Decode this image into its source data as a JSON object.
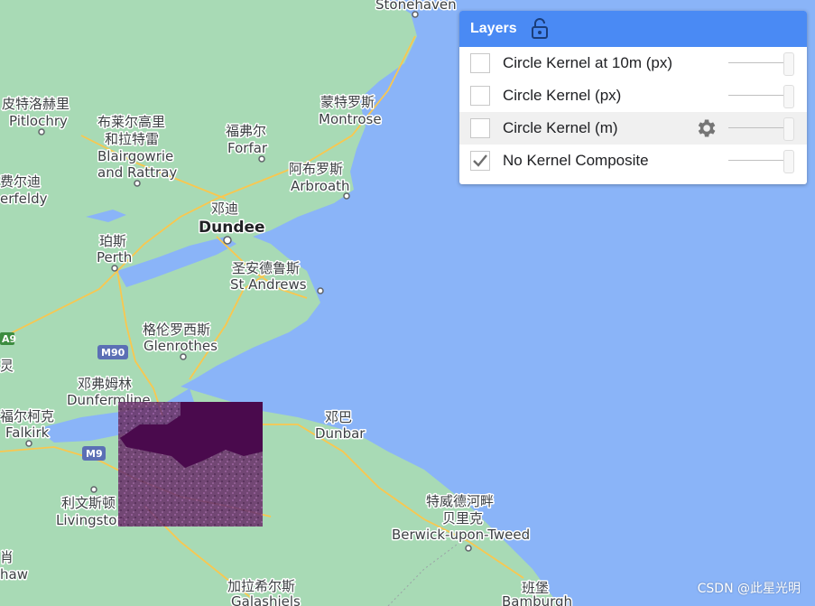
{
  "map": {
    "places": [
      {
        "id": "stonehaven",
        "en": "Stonehaven"
      },
      {
        "id": "pitlochry",
        "zh": "皮特洛赫里",
        "en": "Pitlochry"
      },
      {
        "id": "blairgowrie",
        "zh1": "布莱尔高里",
        "zh2": "和拉特雷",
        "en1": "Blairgowrie",
        "en2": "and Rattray"
      },
      {
        "id": "forfar",
        "zh": "福弗尔",
        "en": "Forfar"
      },
      {
        "id": "montrose",
        "zh": "蒙特罗斯",
        "en": "Montrose"
      },
      {
        "id": "aberfeldy",
        "zh": "费尔迪",
        "en": "erfeldy"
      },
      {
        "id": "arbroath",
        "zh": "阿布罗斯",
        "en": "Arbroath"
      },
      {
        "id": "dundee",
        "zh": "邓迪",
        "en": "Dundee"
      },
      {
        "id": "perth",
        "zh": "珀斯",
        "en": "Perth"
      },
      {
        "id": "standrews",
        "zh": "圣安德鲁斯",
        "en": "St Andrews"
      },
      {
        "id": "glenrothes",
        "zh": "格伦罗西斯",
        "en": "Glenrothes"
      },
      {
        "id": "dunfermline",
        "zh": "邓弗姆林",
        "en": "Dunfermline"
      },
      {
        "id": "falkirk",
        "zh": "福尔柯克",
        "en": "Falkirk"
      },
      {
        "id": "dunbar",
        "zh": "邓巴",
        "en": "Dunbar"
      },
      {
        "id": "livingston",
        "zh": "利文斯顿",
        "en": "Livingston"
      },
      {
        "id": "berwick",
        "zh1": "特威德河畔",
        "zh2": "贝里克",
        "en": "Berwick-upon-Tweed"
      },
      {
        "id": "galashiels",
        "zh": "加拉希尔斯",
        "en": "Galashiels"
      },
      {
        "id": "bamburgh",
        "zh": "班堡",
        "en": "Bamburgh"
      },
      {
        "id": "leftcut1",
        "zh": "灵"
      },
      {
        "id": "leftcut2",
        "zh": "肖",
        "en": "haw"
      }
    ],
    "roads": {
      "a9": "A9",
      "m90": "M90",
      "m9": "M9"
    }
  },
  "layers": {
    "title": "Layers",
    "items": [
      {
        "name": "Circle Kernel at 10m (px)",
        "checked": false
      },
      {
        "name": "Circle Kernel (px)",
        "checked": false
      },
      {
        "name": "Circle Kernel (m)",
        "checked": false
      },
      {
        "name": "No Kernel Composite",
        "checked": true
      }
    ]
  },
  "watermark": "CSDN @此星光明",
  "colors": {
    "land": "#a8dab5",
    "sea": "#8ab4f8",
    "header": "#4a8af4",
    "overlay": "#6b2d6b"
  }
}
